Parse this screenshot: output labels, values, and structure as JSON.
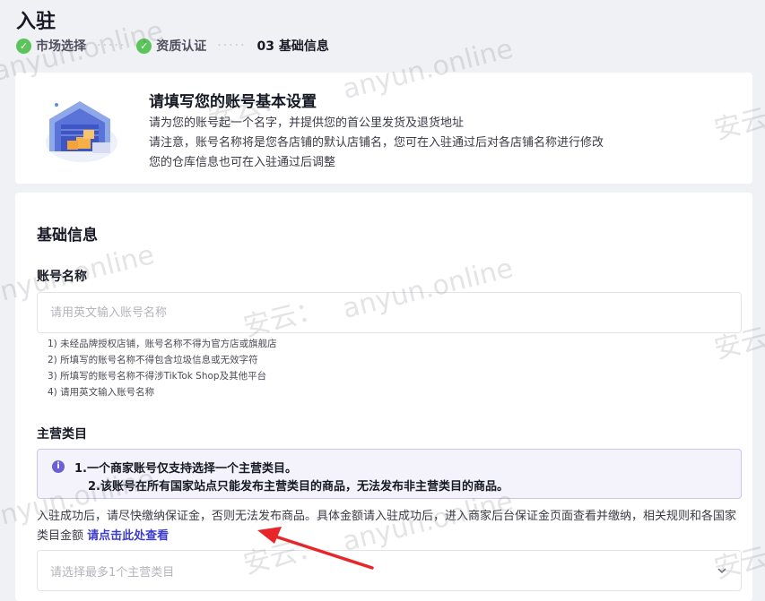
{
  "page": {
    "title": "入驻"
  },
  "steps": [
    {
      "label": "市场选择",
      "status": "done"
    },
    {
      "label": "资质认证",
      "status": "done"
    },
    {
      "label": "03 基础信息",
      "status": "current"
    }
  ],
  "intro": {
    "title": "请填写您的账号基本设置",
    "lines": [
      "请为您的账号起一个名字，并提供您的首公里发货及退货地址",
      "请注意，账号名称将是您各店铺的默认店铺名，您可在入驻通过后对各店铺名称进行修改",
      "您的仓库信息也可在入驻通过后调整"
    ],
    "illustration": "warehouse-icon"
  },
  "basic": {
    "section_title": "基础信息",
    "account_name": {
      "label": "账号名称",
      "placeholder": "请用英文输入账号名称",
      "hints": [
        "1) 未经品牌授权店铺，账号名称不得为官方店或旗舰店",
        "2) 所填写的账号名称不得包含垃圾信息或无效字符",
        "3) 所填写的账号名称不得涉TikTok Shop及其他平台",
        "4) 请用英文输入账号名称"
      ]
    },
    "category": {
      "label": "主营类目",
      "alert_lines": [
        "1.一个商家账号仅支持选择一个主营类目。",
        "2.该账号在所有国家站点只能发布主营类目的商品，无法发布非主营类目的商品。"
      ],
      "deposit_text": "入驻成功后，请尽快缴纳保证金，否则无法发布商品。具体金额请入驻成功后，进入商家后台保证金页面查看并缴纳，相关规则和各国家类目金额",
      "deposit_link": "请点击此处查看",
      "select_placeholder": "请选择最多1个主营类目"
    }
  },
  "watermark": {
    "site": "anyun.online",
    "cn": "安云："
  },
  "colors": {
    "accent": "#3c3ccf",
    "success": "#5bc45a",
    "arrow": "#e8262a",
    "alert_bg": "#f4f3fb"
  }
}
